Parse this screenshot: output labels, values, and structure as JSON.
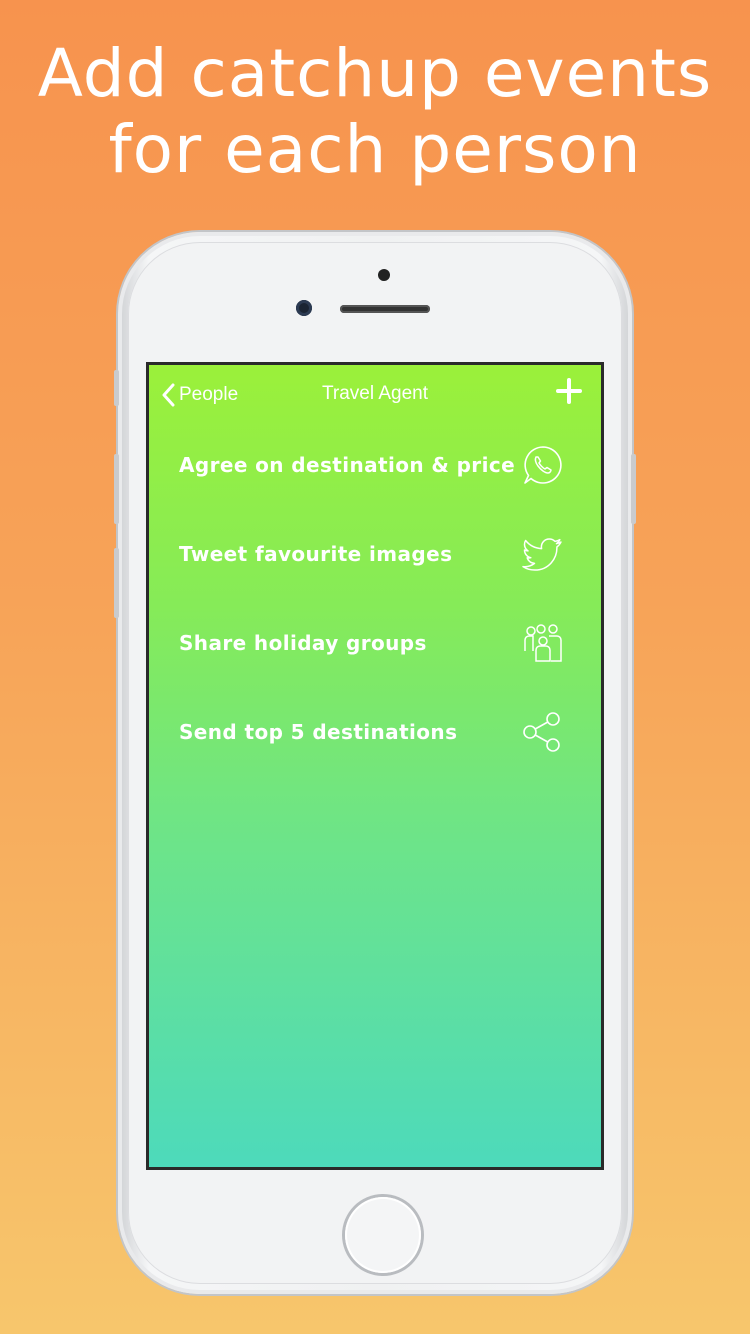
{
  "headline": {
    "line1": "Add catchup events",
    "line2": "for each person"
  },
  "nav": {
    "back_label": "People",
    "back_icon": "chevron-left-icon",
    "title": "Travel Agent",
    "add_icon": "plus-icon"
  },
  "events": [
    {
      "label": "Agree on destination & price",
      "icon": "whatsapp-icon"
    },
    {
      "label": "Tweet favourite images",
      "icon": "twitter-icon"
    },
    {
      "label": "Share holiday groups",
      "icon": "group-icon"
    },
    {
      "label": "Send top 5 destinations",
      "icon": "share-icon"
    }
  ],
  "colors": {
    "background_top": "#F7934E",
    "background_bottom": "#F7C66C",
    "screen_top": "#9BF03A",
    "screen_bottom": "#4DDABB",
    "text": "#FFFFFF"
  }
}
